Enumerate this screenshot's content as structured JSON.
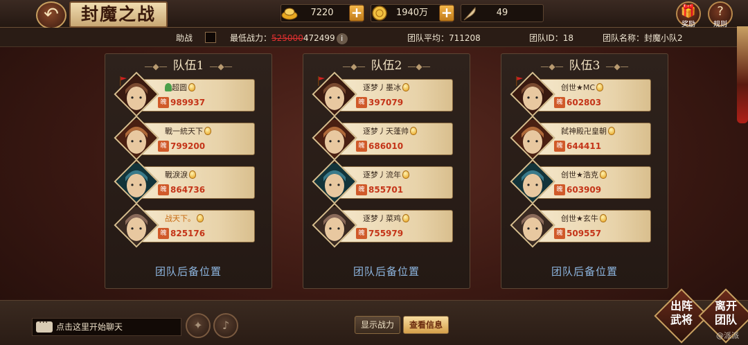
{
  "header": {
    "title": "封魔之战",
    "resources": [
      {
        "icon": "gold-ingot-icon",
        "value": "7220",
        "has_plus": true
      },
      {
        "icon": "coin-icon",
        "value": "1940万",
        "has_plus": true
      },
      {
        "icon": "feather-icon",
        "value": "49",
        "has_plus": false
      }
    ],
    "reward_label": "奖励",
    "rules_label": "规则"
  },
  "info": {
    "assist_label": "助战",
    "min_power_label": "最低战力：",
    "min_power_old": "525000",
    "min_power_new": "472499",
    "team_avg": "团队平均：711208",
    "team_id": "团队ID：18",
    "team_name": "团队名称：封魔小队2"
  },
  "teams": [
    {
      "title": "队伍1",
      "members": [
        {
          "name": "超圆",
          "power": "989937",
          "captain": true,
          "online_icon": true,
          "name_color": "normal"
        },
        {
          "name": "戰一統天下",
          "power": "799200",
          "captain": false,
          "online_icon": false,
          "name_color": "normal"
        },
        {
          "name": "戰淚淚",
          "power": "864736",
          "captain": false,
          "online_icon": false,
          "name_color": "normal"
        },
        {
          "name": "战天下。",
          "power": "825176",
          "captain": false,
          "online_icon": false,
          "name_color": "gold"
        }
      ],
      "backup": "团队后备位置"
    },
    {
      "title": "队伍2",
      "members": [
        {
          "name": "逐梦丿墨冰",
          "power": "397079",
          "captain": true,
          "online_icon": false,
          "name_color": "normal"
        },
        {
          "name": "逐梦丿天蓬帅",
          "power": "686010",
          "captain": false,
          "online_icon": false,
          "name_color": "normal"
        },
        {
          "name": "逐梦丿流年",
          "power": "855701",
          "captain": false,
          "online_icon": false,
          "name_color": "normal"
        },
        {
          "name": "逐梦丿菜鸡",
          "power": "755979",
          "captain": false,
          "online_icon": false,
          "name_color": "normal"
        }
      ],
      "backup": "团队后备位置"
    },
    {
      "title": "队伍3",
      "members": [
        {
          "name": "创世★MC",
          "power": "602803",
          "captain": true,
          "online_icon": false,
          "name_color": "normal"
        },
        {
          "name": "弑神殿卍皇朝",
          "power": "644411",
          "captain": false,
          "online_icon": false,
          "name_color": "normal"
        },
        {
          "name": "创世★浩克",
          "power": "603909",
          "captain": false,
          "online_icon": false,
          "name_color": "normal"
        },
        {
          "name": "创世★玄牛",
          "power": "509557",
          "captain": false,
          "online_icon": false,
          "name_color": "normal"
        }
      ],
      "backup": "团队后备位置"
    }
  ],
  "power_badge": "魄",
  "bottom": {
    "chat_placeholder": "点击这里开始聊天",
    "show_power": "显示战力",
    "check_info": "查看信息",
    "deploy": "出阵武将",
    "leave": "离开团队"
  },
  "watermark": "@派派"
}
